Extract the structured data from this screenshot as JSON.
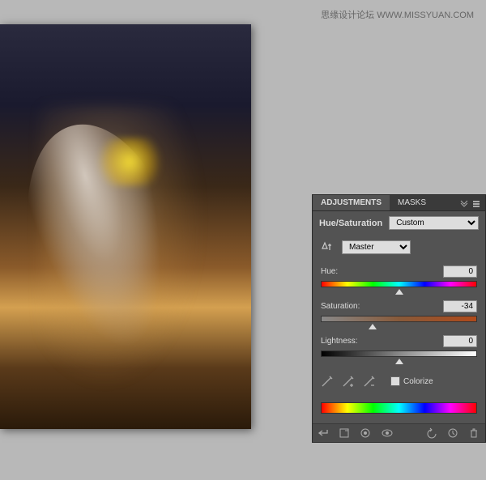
{
  "watermark": "思缘设计论坛 WWW.MISSYUAN.COM",
  "panel": {
    "tabs": {
      "adjustments": "ADJUSTMENTS",
      "masks": "MASKS"
    },
    "title": "Hue/Saturation",
    "preset": "Custom",
    "channel": "Master",
    "sliders": {
      "hue": {
        "label": "Hue:",
        "value": "0",
        "position": 50
      },
      "saturation": {
        "label": "Saturation:",
        "value": "-34",
        "position": 33
      },
      "lightness": {
        "label": "Lightness:",
        "value": "0",
        "position": 50
      }
    },
    "colorize": "Colorize"
  }
}
